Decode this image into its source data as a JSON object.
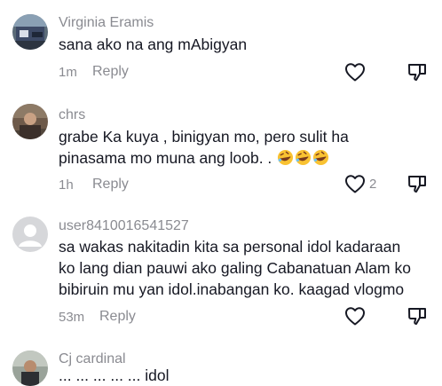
{
  "comments": [
    {
      "username": "Virginia Eramis",
      "text_lines": [
        "sana ako na ang mAbigyan"
      ],
      "time": "1m",
      "reply_label": "Reply",
      "like_count": ""
    },
    {
      "username": "chrs",
      "text_lines": [
        "grabe Ka kuya , binigyan mo, pero sulit ha",
        "pinasama mo muna ang loob. ."
      ],
      "emoji": "rolling-on-floor-laughing",
      "emoji_count": 3,
      "time": "1h",
      "reply_label": "Reply",
      "like_count": "2"
    },
    {
      "username": "user8410016541527",
      "text_lines": [
        "sa wakas nakitadin kita sa personal idol kadaraan",
        "ko lang dian pauwi ako galing Cabanatuan Alam ko",
        "bibiruin mu yan idol.inabangan ko. kaagad vlogmo"
      ],
      "time": "53m",
      "reply_label": "Reply",
      "like_count": ""
    },
    {
      "username": "Cj cardinal",
      "text_lines": [
        "... ... ... ... ... idol"
      ],
      "time": "",
      "reply_label": "",
      "like_count": ""
    }
  ],
  "icons": {
    "like": "heart-outline-icon",
    "dislike": "thumbs-down-outline-icon"
  },
  "colors": {
    "text": "#161823",
    "muted": "#8a8b91",
    "icon": "#161823",
    "emoji_face": "#f9c232"
  }
}
